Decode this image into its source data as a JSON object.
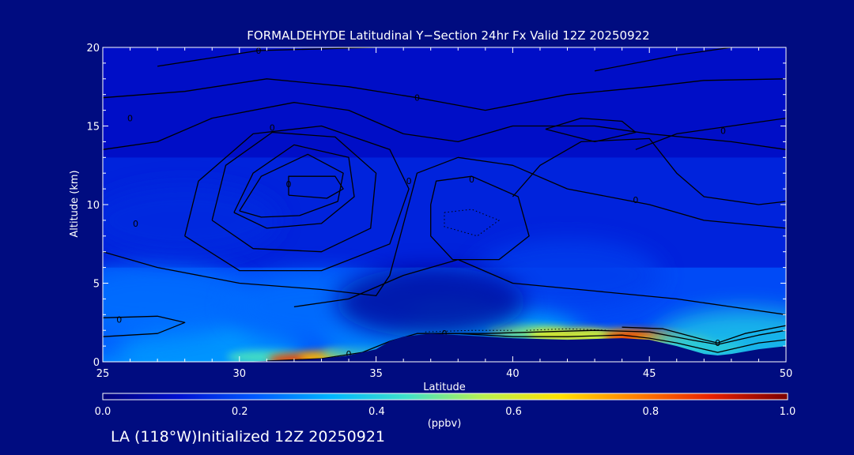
{
  "chart_data": {
    "type": "heatmap",
    "title": "FORMALDEHYDE Latitudinal Y−Section 24hr  Fx Valid 12Z 20250922",
    "xlabel": "Latitude",
    "ylabel": "Altitude (km)",
    "xlim": [
      25,
      50
    ],
    "ylim": [
      0,
      20
    ],
    "x_ticks": [
      25,
      30,
      35,
      40,
      45,
      50
    ],
    "y_ticks": [
      0,
      5,
      10,
      15,
      20
    ],
    "grid": false,
    "colorbar": {
      "min": 0.0,
      "max": 1.0,
      "ticks": [
        "0.0",
        "0.2",
        "0.4",
        "0.6",
        "0.8",
        "1.0"
      ],
      "units": "(ppbv)",
      "colors": [
        "#00007a",
        "#0010d0",
        "#0058ff",
        "#00b4ff",
        "#40e0c8",
        "#b8f050",
        "#ffe000",
        "#ff8000",
        "#e82000",
        "#7a0000"
      ]
    },
    "background_color": "#000c80",
    "surface_profile": {
      "lat": [
        25,
        30,
        32,
        33,
        34,
        35,
        35.5,
        36,
        37,
        38,
        40,
        42,
        44,
        45,
        46,
        47,
        47.5,
        48,
        49,
        50
      ],
      "alt": [
        0,
        0,
        0.1,
        0.2,
        0.4,
        0.8,
        1.3,
        1.6,
        1.8,
        1.7,
        1.5,
        1.4,
        1.5,
        1.4,
        1.0,
        0.5,
        0.4,
        0.5,
        0.8,
        1.0
      ]
    },
    "concentration_field": [
      {
        "lat": 25,
        "alt": 0.3,
        "value": 0.32
      },
      {
        "lat": 27,
        "alt": 0.8,
        "value": 0.3
      },
      {
        "lat": 26,
        "alt": 2.2,
        "value": 0.22
      },
      {
        "lat": 29,
        "alt": 0.4,
        "value": 0.3
      },
      {
        "lat": 31,
        "alt": 0.3,
        "value": 0.45
      },
      {
        "lat": 32.5,
        "alt": 0.15,
        "value": 0.85
      },
      {
        "lat": 33.6,
        "alt": 0.3,
        "value": 0.7
      },
      {
        "lat": 34.5,
        "alt": 0.6,
        "value": 0.5
      },
      {
        "lat": 36.5,
        "alt": 1.9,
        "value": 0.3
      },
      {
        "lat": 39,
        "alt": 1.8,
        "value": 0.32
      },
      {
        "lat": 40.5,
        "alt": 1.9,
        "value": 0.5
      },
      {
        "lat": 42,
        "alt": 1.7,
        "value": 0.62
      },
      {
        "lat": 43.5,
        "alt": 1.6,
        "value": 0.58
      },
      {
        "lat": 44.8,
        "alt": 1.6,
        "value": 0.85
      },
      {
        "lat": 45.8,
        "alt": 1.3,
        "value": 0.72
      },
      {
        "lat": 47,
        "alt": 0.9,
        "value": 0.5
      },
      {
        "lat": 48.5,
        "alt": 1.1,
        "value": 0.38
      },
      {
        "lat": 27,
        "alt": 4.0,
        "value": 0.25
      },
      {
        "lat": 33,
        "alt": 3.5,
        "value": 0.25
      },
      {
        "lat": 28,
        "alt": 9.0,
        "value": 0.15
      },
      {
        "lat": 42,
        "alt": 5.5,
        "value": 0.18
      },
      {
        "lat": 37,
        "alt": 3.8,
        "value": 0.05
      }
    ],
    "contours": [
      {
        "label": "0",
        "label_at": [
          25.6,
          2.7
        ],
        "points": [
          [
            25,
            2.8
          ],
          [
            27,
            2.9
          ],
          [
            28,
            2.5
          ],
          [
            27,
            1.8
          ],
          [
            25,
            1.6
          ]
        ]
      },
      {
        "label": "0",
        "label_at": [
          34,
          0.5
        ],
        "points": [
          [
            31,
            0.05
          ],
          [
            33,
            0.2
          ],
          [
            34.5,
            0.6
          ],
          [
            35.5,
            1.3
          ],
          [
            36.5,
            1.8
          ],
          [
            38,
            1.8
          ],
          [
            40,
            1.6
          ],
          [
            42,
            1.6
          ],
          [
            44,
            1.7
          ],
          [
            45,
            1.5
          ],
          [
            46,
            1.2
          ],
          [
            47.5,
            0.6
          ],
          [
            49,
            1.2
          ],
          [
            50,
            1.4
          ]
        ]
      },
      {
        "label": "0",
        "label_at": [
          37.5,
          1.8
        ],
        "points": [
          [
            37,
            1.8
          ],
          [
            39,
            1.8
          ],
          [
            41,
            1.9
          ],
          [
            43,
            2.0
          ],
          [
            45,
            1.9
          ],
          [
            46.5,
            1.4
          ],
          [
            47.5,
            1.1
          ],
          [
            49,
            1.7
          ],
          [
            50,
            2.0
          ]
        ]
      },
      {
        "label": "0",
        "label_at": [
          47.5,
          1.2
        ],
        "points": [
          [
            44,
            2.2
          ],
          [
            45.5,
            2.1
          ],
          [
            47,
            1.4
          ],
          [
            47.5,
            1.2
          ],
          [
            48.5,
            1.8
          ],
          [
            50,
            2.3
          ]
        ]
      },
      {
        "label": "0",
        "label_at": [
          26.2,
          8.8
        ],
        "points": [
          [
            25,
            7.0
          ],
          [
            27,
            6.0
          ],
          [
            30,
            5.0
          ],
          [
            33,
            4.6
          ],
          [
            35,
            4.2
          ],
          [
            35.5,
            5.5
          ],
          [
            36.5,
            12.0
          ],
          [
            38,
            13.0
          ],
          [
            40,
            12.5
          ],
          [
            42,
            11.0
          ],
          [
            45,
            10.0
          ],
          [
            47,
            9.0
          ],
          [
            50,
            8.5
          ]
        ]
      },
      {
        "label": "",
        "label_at": [
          0,
          0
        ],
        "points": [
          [
            32,
            3.5
          ],
          [
            34,
            4.0
          ],
          [
            36,
            5.5
          ],
          [
            38,
            6.5
          ],
          [
            40,
            5.0
          ],
          [
            43,
            4.5
          ],
          [
            46,
            4.0
          ],
          [
            48,
            3.5
          ],
          [
            50,
            3.0
          ]
        ]
      },
      {
        "label": "0",
        "label_at": [
          26,
          15.5
        ],
        "points": [
          [
            25,
            13.5
          ],
          [
            27,
            14.0
          ],
          [
            29,
            15.5
          ],
          [
            32,
            16.5
          ],
          [
            34,
            16.0
          ],
          [
            36,
            14.5
          ],
          [
            38,
            14.0
          ],
          [
            40,
            15.0
          ],
          [
            43,
            15.0
          ],
          [
            45,
            14.5
          ],
          [
            48,
            14.0
          ],
          [
            50,
            13.5
          ]
        ]
      },
      {
        "label": "0",
        "label_at": [
          36.2,
          11.5
        ],
        "points": [
          [
            28,
            8.0
          ],
          [
            28.5,
            11.5
          ],
          [
            30.5,
            14.5
          ],
          [
            33,
            15.0
          ],
          [
            35.5,
            13.5
          ],
          [
            36.2,
            11.0
          ],
          [
            35.5,
            7.5
          ],
          [
            33,
            5.8
          ],
          [
            30,
            5.8
          ],
          [
            28,
            8.0
          ]
        ]
      },
      {
        "label": "0",
        "label_at": [
          31.2,
          14.9
        ],
        "points": [
          [
            29,
            9.0
          ],
          [
            29.5,
            12.5
          ],
          [
            31.2,
            14.6
          ],
          [
            33.5,
            14.3
          ],
          [
            35,
            12.0
          ],
          [
            34.8,
            8.5
          ],
          [
            33,
            7.0
          ],
          [
            30.5,
            7.2
          ],
          [
            29,
            9.0
          ]
        ]
      },
      {
        "label": "",
        "label_at": [
          0,
          0
        ],
        "points": [
          [
            29.8,
            9.5
          ],
          [
            30.5,
            12.0
          ],
          [
            32,
            13.8
          ],
          [
            34,
            13.0
          ],
          [
            34.2,
            10.5
          ],
          [
            33,
            8.8
          ],
          [
            31,
            8.5
          ],
          [
            29.8,
            9.5
          ]
        ]
      },
      {
        "label": "",
        "label_at": [
          0,
          0
        ],
        "points": [
          [
            30,
            9.6
          ],
          [
            30.8,
            11.8
          ],
          [
            32.5,
            13.2
          ],
          [
            33.8,
            12.0
          ],
          [
            33.6,
            10.2
          ],
          [
            32.2,
            9.3
          ],
          [
            30.8,
            9.2
          ],
          [
            30,
            9.6
          ]
        ]
      },
      {
        "label": "0",
        "label_at": [
          31.8,
          11.3
        ],
        "points": [
          [
            31.8,
            10.6
          ],
          [
            31.8,
            11.8
          ],
          [
            33.5,
            11.8
          ],
          [
            33.8,
            11.0
          ],
          [
            33.2,
            10.4
          ],
          [
            31.8,
            10.6
          ]
        ]
      },
      {
        "label": "0",
        "label_at": [
          38.5,
          11.6
        ],
        "points": [
          [
            37,
            10.0
          ],
          [
            37.2,
            11.5
          ],
          [
            38.5,
            11.8
          ],
          [
            40.2,
            10.5
          ],
          [
            40.6,
            8.0
          ],
          [
            39.5,
            6.5
          ],
          [
            37.8,
            6.5
          ],
          [
            37,
            8.0
          ],
          [
            37,
            10.0
          ]
        ]
      },
      {
        "label": "0",
        "label_at": [
          44.5,
          10.3
        ],
        "points": [
          [
            40,
            10.5
          ],
          [
            41,
            12.5
          ],
          [
            42.5,
            14.0
          ],
          [
            45,
            14.2
          ],
          [
            46,
            12.0
          ],
          [
            47,
            10.5
          ],
          [
            49,
            10.0
          ],
          [
            50,
            10.2
          ]
        ]
      },
      {
        "label": "0",
        "label_at": [
          47.7,
          14.7
        ],
        "points": [
          [
            44.5,
            13.5
          ],
          [
            46,
            14.5
          ],
          [
            48,
            15.0
          ],
          [
            50,
            15.5
          ]
        ]
      },
      {
        "label": "0",
        "label_at": [
          36.5,
          16.8
        ],
        "points": [
          [
            25,
            16.8
          ],
          [
            28,
            17.2
          ],
          [
            31,
            18.0
          ],
          [
            34,
            17.5
          ],
          [
            36.5,
            16.8
          ],
          [
            39,
            16.0
          ],
          [
            42,
            17.0
          ],
          [
            45,
            17.5
          ],
          [
            47,
            17.9
          ],
          [
            50,
            18.0
          ]
        ]
      },
      {
        "label": "0",
        "label_at": [
          30.7,
          19.8
        ],
        "points": [
          [
            27,
            18.8
          ],
          [
            30.7,
            19.8
          ],
          [
            35,
            20.0
          ]
        ]
      },
      {
        "label": "",
        "label_at": [
          0,
          0
        ],
        "points": [
          [
            43,
            18.5
          ],
          [
            46,
            19.5
          ],
          [
            48,
            20.0
          ]
        ]
      },
      {
        "label": "",
        "label_at": [
          0,
          0
        ],
        "points": [
          [
            41.2,
            14.8
          ],
          [
            42.5,
            15.5
          ],
          [
            44,
            15.3
          ],
          [
            44.5,
            14.6
          ],
          [
            43,
            14.0
          ],
          [
            41.2,
            14.8
          ]
        ]
      }
    ],
    "dotted_contours": [
      {
        "points": [
          [
            37.5,
            9.5
          ],
          [
            38.5,
            9.7
          ],
          [
            39.5,
            9.0
          ],
          [
            38.7,
            8.0
          ],
          [
            37.5,
            8.6
          ],
          [
            37.5,
            9.5
          ]
        ]
      },
      {
        "points": [
          [
            36.8,
            1.9
          ],
          [
            38.5,
            2.0
          ],
          [
            40,
            2.0
          ]
        ]
      },
      {
        "points": [
          [
            40.5,
            2.0
          ],
          [
            42,
            2.1
          ],
          [
            43.5,
            2.0
          ]
        ]
      }
    ]
  },
  "footer": {
    "text": "LA (118°W)Initialized 12Z 20250921"
  }
}
